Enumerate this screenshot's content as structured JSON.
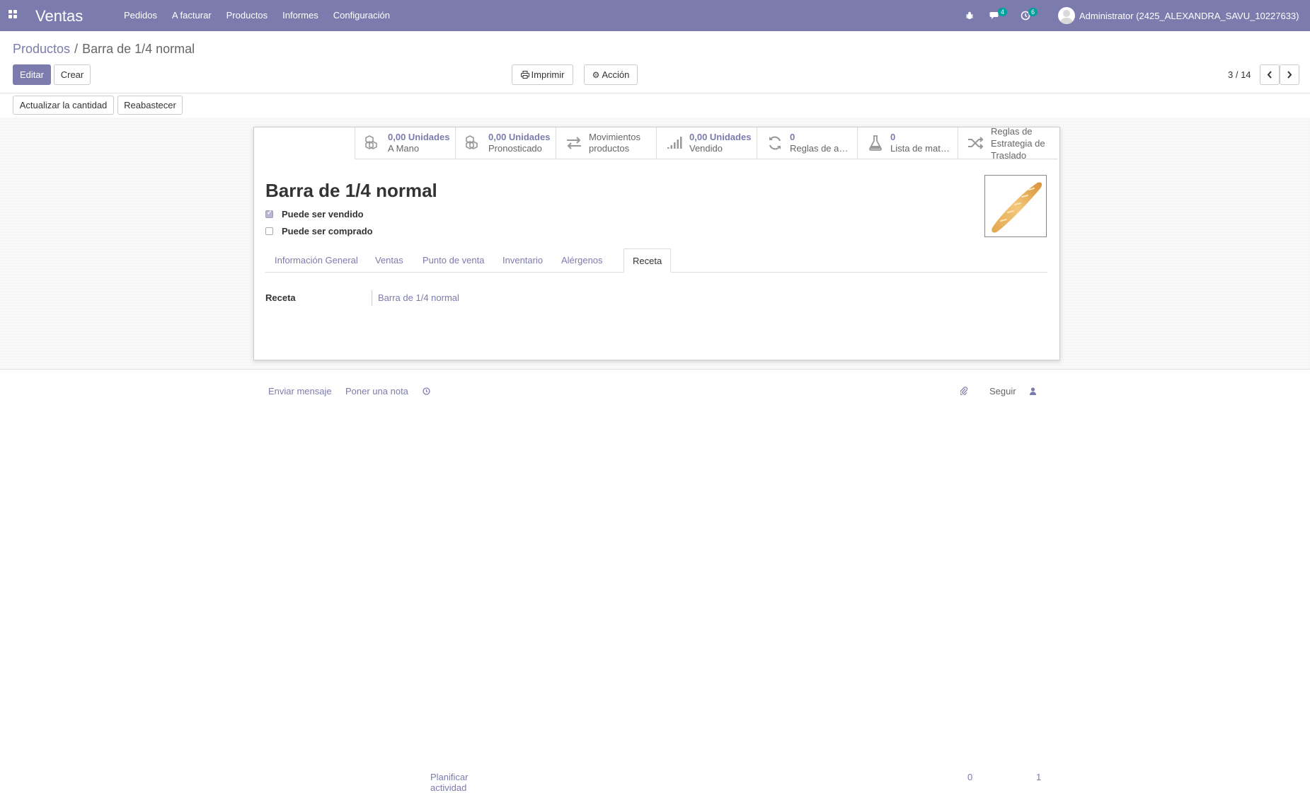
{
  "navbar": {
    "app_name": "Ventas",
    "menu": [
      "Pedidos",
      "A facturar",
      "Productos",
      "Informes",
      "Configuración"
    ],
    "messages_count": "4",
    "activities_count": "6",
    "user": "Administrator (2425_ALEXANDRA_SAVU_10227633)"
  },
  "breadcrumb": {
    "parent": "Productos",
    "separator": "/",
    "current": "Barra de 1/4 normal"
  },
  "buttons": {
    "edit": "Editar",
    "create": "Crear",
    "print": "Imprimir",
    "action": "Acción",
    "update_qty": "Actualizar la cantidad",
    "replenish": "Reabastecer"
  },
  "pager": {
    "value": "3 / 14"
  },
  "stats": [
    {
      "value": "0,00 Unidades",
      "label": "A Mano",
      "icon": "cubes-icon"
    },
    {
      "value": "0,00 Unidades",
      "label": "Pronosticado",
      "icon": "cubes-icon"
    },
    {
      "plain1": "Movimientos",
      "plain2": "productos",
      "icon": "exchange-icon"
    },
    {
      "value": "0,00 Unidades",
      "label": "Vendido",
      "icon": "signal-icon"
    },
    {
      "value": "0",
      "label": "Reglas de a…",
      "icon": "refresh-icon"
    },
    {
      "value": "0",
      "label": "Lista de mat…",
      "icon": "flask-icon"
    },
    {
      "plain1": "Reglas de",
      "plain2": "Estrategia de",
      "plain3": "Traslado",
      "icon": "random-icon"
    }
  ],
  "product": {
    "name": "Barra de 1/4 normal",
    "can_be_sold_label": "Puede ser vendido",
    "can_be_sold": true,
    "can_be_purchased_label": "Puede ser comprado",
    "can_be_purchased": false
  },
  "tabs": [
    "Información General",
    "Ventas",
    "Punto de venta",
    "Inventario",
    "Alérgenos",
    "Receta"
  ],
  "active_tab": "Receta",
  "recipe": {
    "label": "Receta",
    "value": "Barra de 1/4 normal"
  },
  "chatter": {
    "send_message": "Enviar mensaje",
    "log_note": "Poner una nota",
    "schedule": "Planificar actividad",
    "attachments": "0",
    "follow": "Seguir",
    "followers": "1"
  },
  "colors": {
    "brand": "#7c7bad",
    "badge": "#00a09d"
  }
}
